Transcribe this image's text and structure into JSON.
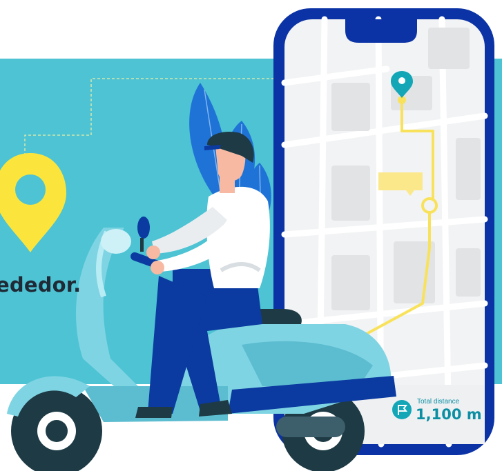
{
  "banner": {
    "text_fragment": "ededor."
  },
  "phone": {
    "distance_label": "Total distance",
    "distance_value": "1,100 m"
  },
  "colors": {
    "background_teal": "#4dc3d3",
    "phone_frame": "#0b33a6",
    "route_yellow": "#f9e25b",
    "pin_yellow": "#fbe53c",
    "pin_teal": "#12a6b6",
    "scooter_light": "#7fd4e3",
    "scooter_dark": "#1d3a45",
    "jeans_blue": "#0b3aa0",
    "shirt_white": "#ffffff",
    "text_dark": "#1f2a36",
    "distance_teal": "#0d8fa3"
  },
  "icons": [
    "location-pin-icon",
    "map-pin-icon",
    "flag-icon"
  ]
}
